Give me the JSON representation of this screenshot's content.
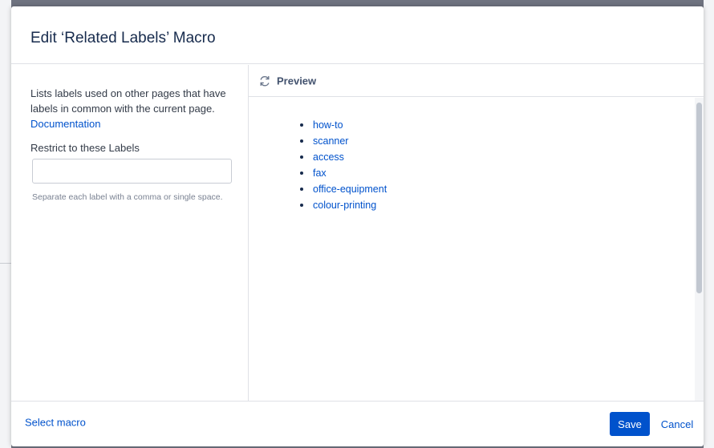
{
  "dialog": {
    "title": "Edit ‘Related Labels’ Macro"
  },
  "macro_params": {
    "description": "Lists labels used on other pages that have labels in common with the current page.",
    "documentation_link": "Documentation",
    "restrict_label": "Restrict to these Labels",
    "restrict_value": "",
    "restrict_help": "Separate each label with a comma or single space."
  },
  "preview": {
    "refresh_icon": "refresh-icon",
    "title": "Preview",
    "labels": [
      "how-to",
      "scanner",
      "access",
      "fax",
      "office-equipment",
      "colour-printing"
    ]
  },
  "footer": {
    "select_macro": "Select macro",
    "save": "Save",
    "cancel": "Cancel"
  },
  "colors": {
    "accent": "#0052cc",
    "text": "#172b4d",
    "border": "#dfe1e6"
  }
}
